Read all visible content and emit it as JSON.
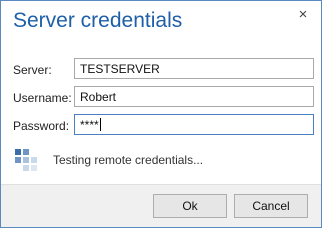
{
  "dialog": {
    "title": "Server credentials",
    "close_glyph": "×"
  },
  "form": {
    "server_label": "Server:",
    "server_value": "TESTSERVER",
    "username_label": "Username:",
    "username_value": "Robert",
    "password_label": "Password:",
    "password_value": "****"
  },
  "status": {
    "text": "Testing remote credentials...",
    "icon": "progress-squares-icon"
  },
  "buttons": {
    "ok": "Ok",
    "cancel": "Cancel"
  },
  "colors": {
    "title": "#1f5fa8",
    "border": "#5a8bc0",
    "spinner_dark": "#3b6ea8",
    "spinner_light": "#a9c2de"
  }
}
